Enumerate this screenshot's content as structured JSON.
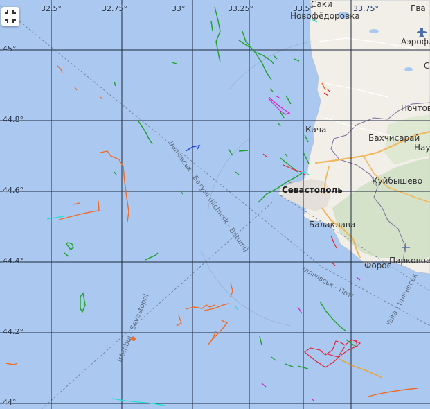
{
  "map": {
    "grid_lon_labels": [
      "32.5°",
      "32.75°",
      "33°",
      "33.25°",
      "33.5°",
      "33.75°"
    ],
    "grid_lat_labels": [
      "45°",
      "44.8°",
      "44.6°",
      "44.4°",
      "44.2°",
      "44°"
    ],
    "places": [
      {
        "key": "saki",
        "text": "Саки"
      },
      {
        "key": "novofedorovka",
        "text": "Новофёдоровка"
      },
      {
        "key": "gvardeyskoe",
        "text": "Гва"
      },
      {
        "key": "aeroflot",
        "text": "Аэрофл"
      },
      {
        "key": "pochtovoe",
        "text": "Почтов"
      },
      {
        "key": "kacha",
        "text": "Кача"
      },
      {
        "key": "bakhchisaray",
        "text": "Бахчисарай"
      },
      {
        "key": "nau",
        "text": "Нау"
      },
      {
        "key": "kuibyshevo",
        "text": "Куйбышево"
      },
      {
        "key": "sevastopol",
        "text": "Севастополь"
      },
      {
        "key": "balaklava",
        "text": "Балаклава"
      },
      {
        "key": "foros",
        "text": "Форос"
      },
      {
        "key": "parkovoe",
        "text": "Парковое"
      },
      {
        "key": "c_edge",
        "text": "С"
      }
    ],
    "routes": [
      {
        "key": "ilichivsk_batumi",
        "text": "Іллічівськ - Батумі (Ilichivsk - Batumi)"
      },
      {
        "key": "ilichivsk_poti",
        "text": "Іллічівськ - Поті"
      },
      {
        "key": "yalta_ilichivsk",
        "text": "Yalta - Іллічівськ"
      },
      {
        "key": "istanbul_sevastopol",
        "text": "Istanbul - Sevastopol"
      }
    ],
    "colors": {
      "sea": "#aac8f0",
      "land": "#f2efe9",
      "hills": "#cfe0c4",
      "grid": "#1f2a3a",
      "track_green": "#1fa02a",
      "track_orange": "#f06a28",
      "track_red": "#e41b2a",
      "track_magenta": "#d020c8",
      "track_cyan": "#20e0d0",
      "track_blue": "#2040e0",
      "road": "#f0b860"
    },
    "controls": {
      "fullscreen_icon": "fullscreen-icon"
    }
  }
}
